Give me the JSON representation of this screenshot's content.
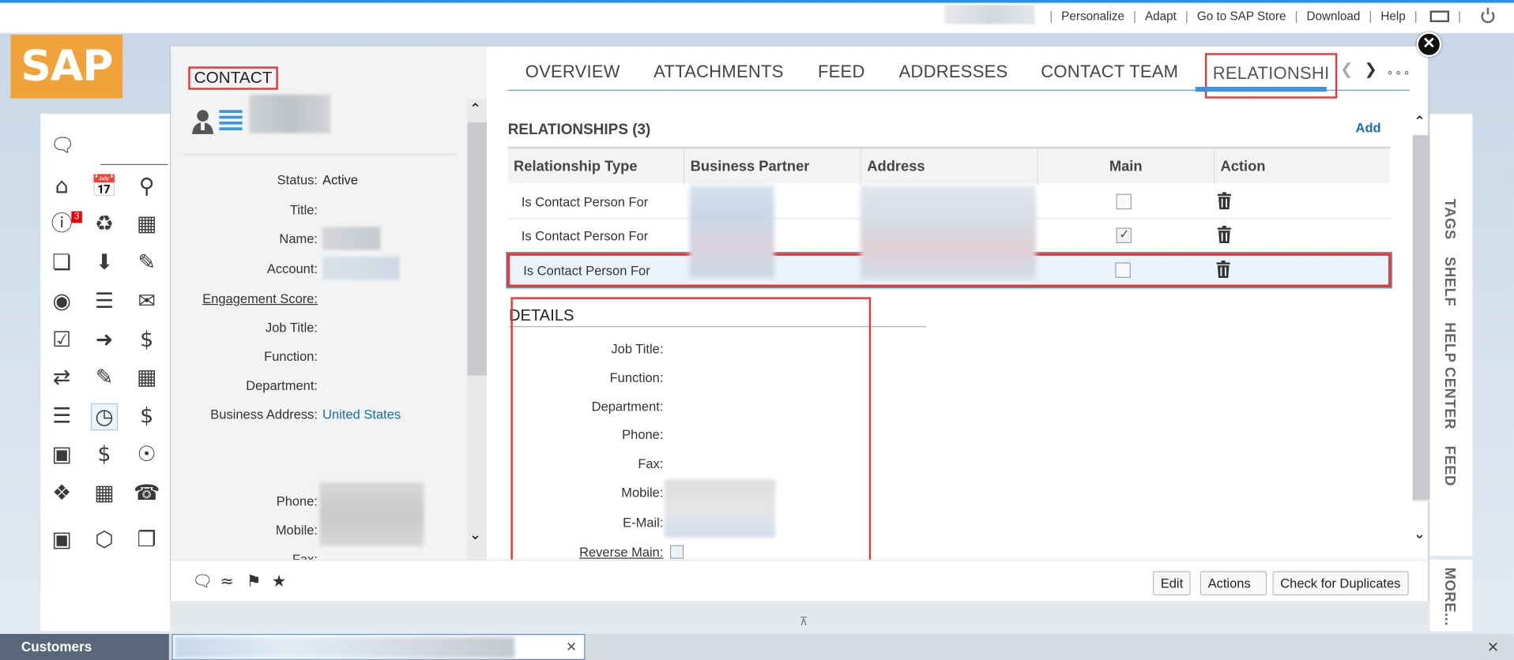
{
  "topbar": {
    "links": [
      "Personalize",
      "Adapt",
      "Go to SAP Store",
      "Download",
      "Help"
    ]
  },
  "logo": "SAP",
  "sidebar": {
    "alerts_count": "3"
  },
  "contact": {
    "title": "CONTACT",
    "fields": [
      {
        "label": "Status:",
        "value": "Active"
      },
      {
        "label": "Title:",
        "value": ""
      },
      {
        "label": "Name:",
        "value": ""
      },
      {
        "label": "Account:",
        "value": ""
      },
      {
        "label": "Engagement Score:",
        "value": ""
      },
      {
        "label": "Job Title:",
        "value": ""
      },
      {
        "label": "Function:",
        "value": ""
      },
      {
        "label": "Department:",
        "value": ""
      },
      {
        "label": "Business Address:",
        "value": "United States"
      },
      {
        "label": "Phone:",
        "value": ""
      },
      {
        "label": "Mobile:",
        "value": ""
      },
      {
        "label": "Fax:",
        "value": ""
      }
    ]
  },
  "tabs": [
    "OVERVIEW",
    "ATTACHMENTS",
    "FEED",
    "ADDRESSES",
    "CONTACT TEAM",
    "RELATIONSHI"
  ],
  "relationships": {
    "title": "RELATIONSHIPS (3)",
    "add_label": "Add",
    "columns": [
      "Relationship Type",
      "Business Partner",
      "Address",
      "Main",
      "Action"
    ],
    "rows": [
      {
        "type": "Is Contact Person For",
        "main": false
      },
      {
        "type": "Is Contact Person For",
        "main": true
      },
      {
        "type": "Is Contact Person For",
        "main": false
      }
    ]
  },
  "details": {
    "title": "DETAILS",
    "fields": [
      "Job Title:",
      "Function:",
      "Department:",
      "Phone:",
      "Fax:",
      "Mobile:",
      "E-Mail:",
      "Reverse Main:"
    ]
  },
  "footer": {
    "buttons": [
      "Edit",
      "Actions",
      "Check for Duplicates"
    ]
  },
  "rightbar": {
    "tabs": [
      "TAGS",
      "SHELF",
      "HELP CENTER",
      "FEED"
    ],
    "more": "MORE..."
  },
  "taskbar": {
    "customers": "Customers"
  },
  "colors": {
    "accent": "#2d8fe0",
    "highlight": "#e03b3b",
    "sap_brand": "#f0a33b"
  }
}
